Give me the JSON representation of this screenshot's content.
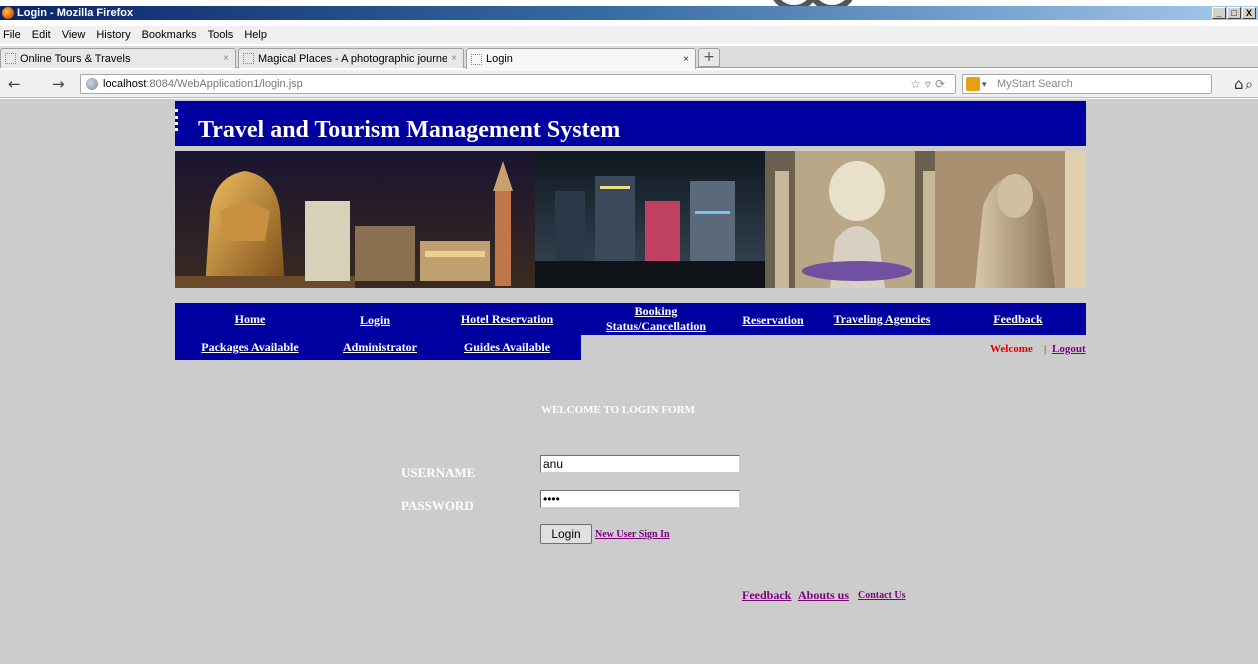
{
  "window": {
    "title": "Login - Mozilla Firefox",
    "buttons": [
      "_",
      "□",
      "X"
    ]
  },
  "menubar": [
    "File",
    "Edit",
    "View",
    "History",
    "Bookmarks",
    "Tools",
    "Help"
  ],
  "tabs": [
    {
      "label": "Online Tours & Travels",
      "active": false
    },
    {
      "label": "Magical Places - A photographic journey ...",
      "active": false
    },
    {
      "label": "Login",
      "active": true
    }
  ],
  "new_tab_label": "+",
  "address": {
    "host": "localhost",
    "path": ":8084/WebApplication1/login.jsp"
  },
  "search": {
    "placeholder": "MyStart Search"
  },
  "page": {
    "site_title": "Travel and Tourism Management System",
    "nav_row1": [
      "Home",
      "Login",
      "Hotel Reservation",
      "Booking",
      "Status/Cancellation",
      "Reservation",
      "Traveling Agencies",
      "Feedback"
    ],
    "nav_row2": [
      "Packages Available",
      "Administrator",
      "Guides Available"
    ],
    "welcome": "Welcome",
    "separator": "|",
    "logout": "Logout",
    "form": {
      "title": "WELCOME TO LOGIN FORM",
      "username_label": "USERNAME",
      "password_label": "PASSWORD",
      "username_value": "anu",
      "password_value": "••••",
      "login_button": "Login",
      "signup_link": "New User Sign In"
    },
    "footer": [
      "Feedback",
      "Abouts us",
      "Contact Us"
    ]
  },
  "colors": {
    "page_bg": "#cccccc",
    "header_blue": "#0000a0",
    "welcome_red": "#e00000",
    "visited_link": "#800080"
  }
}
